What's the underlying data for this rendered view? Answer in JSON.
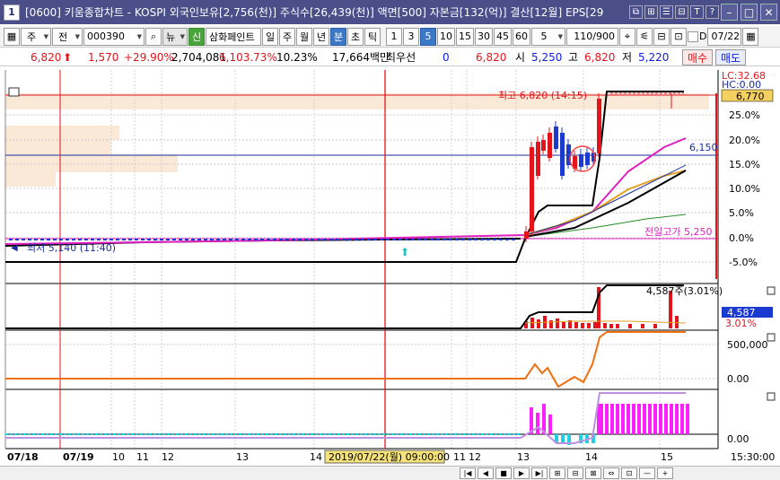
{
  "window": {
    "app_number": "1",
    "title": "[0600] 키움종합차트 - KOSPI 외국인보유[2,756(천)] 주식수[26,439(천)] 액면[500] 자본금[132(억)] 결산[12월] EPS[29",
    "title_buttons": [
      "⧉",
      "⊞",
      "☰",
      "⊟",
      "T",
      "?"
    ],
    "window_buttons": [
      "–",
      "□",
      "✕"
    ]
  },
  "toolbar": {
    "num_icon": "▦",
    "kind1": "주",
    "kind2": "전",
    "code": "000390",
    "news": "뉴",
    "sin": "신",
    "stock_name": "삼화페인트",
    "periods": [
      "일",
      "주",
      "월",
      "년",
      "분",
      "초",
      "틱"
    ],
    "selected_period": "분",
    "intervals": [
      "1",
      "3",
      "5",
      "10",
      "15",
      "30",
      "45",
      "60"
    ],
    "selected_interval": "5",
    "interval_combo": "5",
    "count": "110/900",
    "tool_icons": [
      "⌖",
      "⚟",
      "⊟",
      "⊡"
    ],
    "checkbox_label": "D",
    "date": "07/22"
  },
  "quote": {
    "price": "6,820",
    "change": "1,570",
    "change_pct": "+29.90%",
    "volume": "2,704,081",
    "vol_pct": "6,103.73%",
    "turnover": "10.23%",
    "amount": "17,664백만",
    "best_label": "최우선",
    "best_value": "0",
    "best_price": "6,820",
    "open_label": "시",
    "open": "5,250",
    "high_label": "고",
    "high": "6,820",
    "low_label": "저",
    "low": "5,220",
    "buy": "매수",
    "sell": "매도"
  },
  "chart_labels": {
    "high_annot": "최고 6,820 (14:15)",
    "low_annot": "최저 5,140 (11:40)",
    "prev_high_annot": "전일고가 5,250",
    "line_value": "6,150",
    "lc_label": "LC:32.68",
    "hc_label": "HC:0.00",
    "price_box": "6,770",
    "vol_annot": "4,587주(3.01%)",
    "vol_box": "4,587",
    "vol_pct_box": "3.01%",
    "date_box": "2019/07/22(월) 09:00:00",
    "time_label": "15:30:00"
  },
  "chart_data": {
    "type": "candlestick",
    "price_axis": [
      "25.0%",
      "20.0%",
      "15.0%",
      "10.0%",
      "5.0%",
      "0.0%",
      "-5.0%"
    ],
    "volume_axis": [],
    "obv_axis": [
      "500,000",
      "0.00"
    ],
    "macd_axis": [
      "0.00"
    ],
    "x_ticks": [
      "07/18",
      "07/19",
      "10",
      "11",
      "12",
      "13",
      "14",
      "10",
      "11",
      "12",
      "13",
      "14",
      "15"
    ]
  },
  "colors": {
    "up": "#e3141b",
    "down": "#1a3ad0",
    "ma5": "#e020c0",
    "ma20": "#e0a020",
    "ma60": "#1a2ea0",
    "ma120": "#2a8a2a",
    "obv": "#f07010",
    "macd_bar": "#ff20ff",
    "macd_neg": "#20d0e0",
    "signal": "#c090e0"
  },
  "bottom": {
    "nav_buttons": [
      "|◀",
      "◀",
      "■",
      "▶",
      "▶|",
      "⊞",
      "⊟",
      "⊠",
      "⇔",
      "⊡",
      "—",
      "+"
    ]
  }
}
